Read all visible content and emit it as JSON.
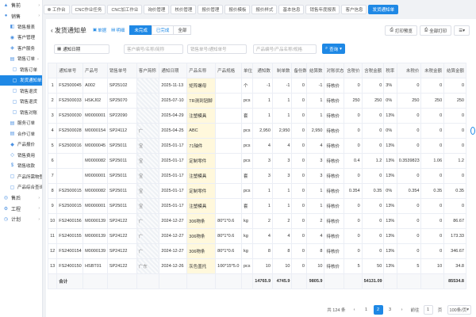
{
  "sidebar": {
    "items": [
      {
        "label": "售前",
        "icon": "store-icon",
        "level": 1
      },
      {
        "label": "销售",
        "icon": "cart-icon",
        "level": 1
      },
      {
        "label": "销售报表",
        "icon": "report-icon",
        "level": 2
      },
      {
        "label": "客户管理",
        "icon": "customer-icon",
        "level": 2
      },
      {
        "label": "客户服务",
        "icon": "service-icon",
        "level": 2
      },
      {
        "label": "销售订单",
        "icon": "order-icon",
        "level": 2
      },
      {
        "label": "销售订单",
        "icon": "doc-icon",
        "level": 3
      },
      {
        "label": "发货通知单",
        "icon": "doc-icon",
        "level": 3,
        "active": true
      },
      {
        "label": "销售退货",
        "icon": "doc-icon",
        "level": 3
      },
      {
        "label": "销售退货",
        "icon": "doc-icon",
        "level": 3
      },
      {
        "label": "销售对账",
        "icon": "doc-icon",
        "level": 3
      },
      {
        "label": "服务订单",
        "icon": "order-icon",
        "level": 2
      },
      {
        "label": "合作订单",
        "icon": "order-icon",
        "level": 2
      },
      {
        "label": "产品报价",
        "icon": "price-icon",
        "level": 2
      },
      {
        "label": "销售费用",
        "icon": "fee-icon",
        "level": 2
      },
      {
        "label": "销售收款",
        "icon": "money-icon",
        "level": 2
      },
      {
        "label": "产品所需物登记",
        "icon": "doc-icon",
        "level": 2
      },
      {
        "label": "产品综合查询",
        "icon": "doc-icon",
        "level": 2
      },
      {
        "label": "售后",
        "icon": "aftersale-icon",
        "level": 1
      },
      {
        "label": "工程",
        "icon": "engineering-icon",
        "level": 1
      },
      {
        "label": "计划",
        "icon": "plan-icon",
        "level": 1
      }
    ]
  },
  "tabs": [
    {
      "label": "工作台",
      "active": false
    },
    {
      "label": "CNC作业任务",
      "active": false
    },
    {
      "label": "CNC加工作业",
      "active": false
    },
    {
      "label": "询价管理",
      "active": false
    },
    {
      "label": "核价管理",
      "active": false
    },
    {
      "label": "报价管理",
      "active": false
    },
    {
      "label": "报价模板",
      "active": false
    },
    {
      "label": "报价样式",
      "active": false
    },
    {
      "label": "基本信息",
      "active": false
    },
    {
      "label": "销售年度报表",
      "active": false
    },
    {
      "label": "客户信息",
      "active": false
    },
    {
      "label": "发货通知单",
      "active": true
    }
  ],
  "header": {
    "title": "发货通知单",
    "view_toggles": [
      "单据",
      "明细"
    ],
    "status_tabs": [
      "未完成",
      "已完成",
      "全部"
    ],
    "print_preview": "打印预览",
    "print_all": "全部打印"
  },
  "filters": {
    "doc_no": "通知日期",
    "customer_placeholder": "客户编号/名称/简称",
    "order_placeholder": "销售单号/通知单号",
    "product_placeholder": "产品编号/产品名称/规格",
    "search_label": "查询"
  },
  "table": {
    "columns": [
      "",
      "通知单号",
      "产品号",
      "销售单号",
      "客户简称",
      "通知日期",
      "产品名称",
      "产品规格",
      "单位",
      "通知数",
      "制单数",
      "备份数",
      "结算数",
      "对账状态",
      "含税价",
      "含税金额",
      "税率",
      "未税价",
      "未税金额",
      "结算金额"
    ],
    "rows": [
      [
        "1",
        "FS2500045",
        "A002",
        "SP25102",
        "",
        "2025-11-13",
        "矩阵螺母",
        "",
        "个",
        "-1",
        "-1",
        "0",
        "-1",
        "待核价",
        "0",
        "0",
        "3%",
        "0",
        "0",
        "0"
      ],
      [
        "2",
        "FS2500033",
        "HSKJ02",
        "SP25070",
        "",
        "2025-07-10",
        "TR测到钮脚",
        "",
        "pcs",
        "1",
        "1",
        "0",
        "1",
        "待核价",
        "250",
        "250",
        "0%",
        "250",
        "250",
        "250"
      ],
      [
        "3",
        "FS2500030",
        "M0000001",
        "SP22090",
        "",
        "2025-04-29",
        "注塑模具",
        "",
        "套",
        "1",
        "1",
        "0",
        "1",
        "待核价",
        "0",
        "0",
        "13%",
        "0",
        "0",
        "0"
      ],
      [
        "4",
        "FS2500028",
        "M0000154",
        "SP24112",
        "广",
        "2025-04-25",
        "ABC",
        "",
        "pcs",
        "2,950",
        "2,950",
        "0",
        "2,950",
        "待核价",
        "0",
        "0",
        "0%",
        "0",
        "0",
        "0"
      ],
      [
        "5",
        "FS2500016",
        "M0000045",
        "SP25011",
        "宝",
        "2025-01-17",
        "71轴件",
        "",
        "pcs",
        "4",
        "4",
        "0",
        "4",
        "待核价",
        "0",
        "0",
        "13%",
        "0",
        "0",
        "0"
      ],
      [
        "6",
        "",
        "M0000082",
        "SP25011",
        "宝",
        "2025-01-17",
        "定制零件",
        "",
        "pcs",
        "3",
        "3",
        "0",
        "3",
        "待核价",
        "0.4",
        "1.2",
        "13%",
        "0.3539823",
        "1.06",
        "1.2"
      ],
      [
        "7",
        "",
        "M0000001",
        "SP25011",
        "宝",
        "2025-01-17",
        "注塑模具",
        "",
        "套",
        "3",
        "3",
        "0",
        "3",
        "待核价",
        "0",
        "0",
        "13%",
        "0",
        "0",
        "0"
      ],
      [
        "8",
        "FS2500015",
        "M0000082",
        "SP25011",
        "宝",
        "2025-01-17",
        "定制零件",
        "",
        "pcs",
        "1",
        "1",
        "0",
        "1",
        "待核价",
        "0.354",
        "0.35",
        "0%",
        "0.354",
        "0.35",
        "0.35"
      ],
      [
        "9",
        "FS2500015",
        "M0000001",
        "SP25011",
        "宝",
        "2025-01-17",
        "注塑模具",
        "",
        "套",
        "1",
        "1",
        "0",
        "1",
        "待核价",
        "0",
        "0",
        "13%",
        "0",
        "0",
        "0"
      ],
      [
        "10",
        "FS2400156",
        "M0000139",
        "SP24122",
        "广",
        "2024-12-27",
        "306物条",
        "80*1*0.6",
        "kg",
        "2",
        "2",
        "0",
        "2",
        "待核价",
        "0",
        "0",
        "13%",
        "0",
        "0",
        "86.67"
      ],
      [
        "11",
        "FS2400155",
        "M0000139",
        "SP24122",
        "广",
        "2024-12-27",
        "306物条",
        "80*1*0.6",
        "kg",
        "4",
        "4",
        "0",
        "4",
        "待核价",
        "0",
        "0",
        "13%",
        "0",
        "0",
        "173.33"
      ],
      [
        "12",
        "FS2400154",
        "M0000139",
        "SP24122",
        "广",
        "2024-12-27",
        "306物条",
        "80*1*0.6",
        "kg",
        "8",
        "8",
        "0",
        "8",
        "待核价",
        "0",
        "0",
        "13%",
        "0",
        "0",
        "346.67"
      ],
      [
        "13",
        "FS2400150",
        "HSBT01",
        "SP24122",
        "广东",
        "2024-12-26",
        "灰色盖托",
        "100*15*5.0",
        "pcs",
        "10",
        "10",
        "0",
        "10",
        "待核价",
        "5",
        "50",
        "13%",
        "5",
        "10",
        "34.8"
      ]
    ],
    "total_label": "合计",
    "totals": {
      "notify": "14765.9",
      "made": "4745.9",
      "settle": "9805.9",
      "tax_amount": "54131.09",
      "settle_amount": "85534.8"
    }
  },
  "pagination": {
    "total": "共 124 条",
    "pages": [
      "1",
      "2",
      "3"
    ],
    "current": "2",
    "goto_label": "前往",
    "goto_value": "1",
    "page_suffix": "页",
    "page_size": "100条/页"
  },
  "colors": {
    "accent": "#1e88e5"
  }
}
